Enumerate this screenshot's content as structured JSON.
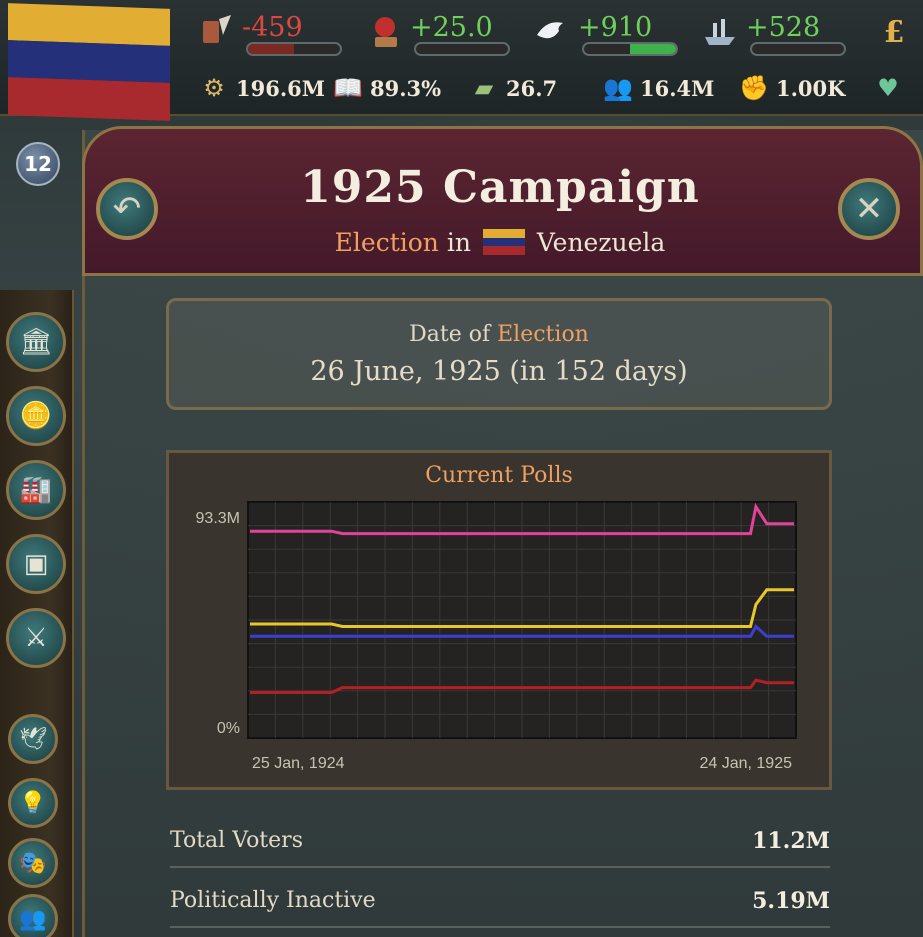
{
  "topbar": {
    "rank_number": "12",
    "primary_stats": [
      {
        "icon": "quill-icon",
        "value": "-459",
        "color": "#e0483f",
        "bar_fill": 0.5,
        "bar_color": "#c0392b"
      },
      {
        "icon": "seal-icon",
        "value": "+25.0",
        "color": "#6fd05a",
        "bar_fill": 0.0,
        "bar_color": "#3fb04a"
      },
      {
        "icon": "dove-icon",
        "value": "+910",
        "color": "#6fd05a",
        "bar_fill": 0.5,
        "bar_color": "#3fb04a"
      },
      {
        "icon": "ship-icon",
        "value": "+528",
        "color": "#6fd05a",
        "bar_fill": 0.0,
        "bar_color": "#3fb04a"
      }
    ],
    "secondary_stats": [
      {
        "icon": "gdp-icon",
        "value": "196.6M"
      },
      {
        "icon": "literacy-icon",
        "value": "89.3%"
      },
      {
        "icon": "money-icon",
        "value": "26.7"
      },
      {
        "icon": "population-icon",
        "value": "16.4M"
      },
      {
        "icon": "fist-icon",
        "value": "1.00K"
      }
    ]
  },
  "campaign": {
    "title": "1925 Campaign",
    "subtitle_prefix": "Election",
    "subtitle_mid": "in",
    "country": "Venezuela",
    "date_label_prefix": "Date of",
    "date_label_highlight": "Election",
    "date_value": "26 June, 1925 (in 152 days)",
    "polls_title": "Current Polls"
  },
  "chart_data": {
    "type": "line",
    "title": "Current Polls",
    "y_tick_labels": [
      "93.3M",
      "0%"
    ],
    "x_tick_labels": [
      "25 Jan, 1924",
      "24 Jan, 1925"
    ],
    "ylim": [
      0,
      93.3
    ],
    "grid": true,
    "x": [
      0,
      0.15,
      0.17,
      0.92,
      0.93,
      0.95,
      1.0
    ],
    "series": [
      {
        "color": "#e0449a",
        "values": [
          83,
          83,
          82,
          82,
          93,
          86,
          86
        ]
      },
      {
        "color": "#e7c72a",
        "values": [
          45,
          45,
          44,
          44,
          53,
          59,
          59
        ]
      },
      {
        "color": "#3b3fd0",
        "values": [
          40,
          40,
          40,
          40,
          44,
          40,
          40
        ]
      },
      {
        "color": "#b22024",
        "values": [
          17,
          17,
          19,
          19,
          22,
          21,
          21
        ]
      }
    ]
  },
  "stats": [
    {
      "label": "Total Voters",
      "value": "11.2M"
    },
    {
      "label": "Politically Inactive",
      "value": "5.19M"
    }
  ],
  "sidebar": {
    "buttons": [
      "government-icon",
      "coins-icon",
      "factory-icon",
      "crate-icon",
      "swords-icon",
      "dove-icon",
      "lightbulb-icon",
      "theater-mask-icon",
      "people-icon"
    ]
  }
}
